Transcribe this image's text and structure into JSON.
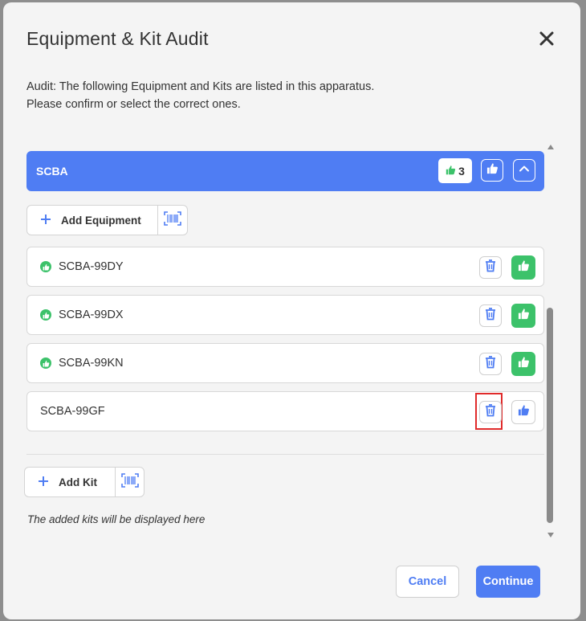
{
  "dialog": {
    "title": "Equipment & Kit Audit",
    "intro_line1": "Audit: The following Equipment and Kits are listed in this apparatus.",
    "intro_line2": "Please confirm or select the correct ones."
  },
  "group": {
    "name": "SCBA",
    "confirmed_count": "3"
  },
  "add_equipment": {
    "label": "Add Equipment"
  },
  "items": [
    {
      "label": "SCBA-99DY",
      "confirmed": true
    },
    {
      "label": "SCBA-99DX",
      "confirmed": true
    },
    {
      "label": "SCBA-99KN",
      "confirmed": true
    },
    {
      "label": "SCBA-99GF",
      "confirmed": false
    }
  ],
  "add_kit": {
    "label": "Add Kit"
  },
  "kits_empty_note": "The added kits will be displayed here",
  "footer": {
    "cancel_label": "Cancel",
    "continue_label": "Continue"
  },
  "colors": {
    "accent": "#4f7df3",
    "confirmed_green": "#3cc26a",
    "highlight_red": "#e02b2b"
  }
}
